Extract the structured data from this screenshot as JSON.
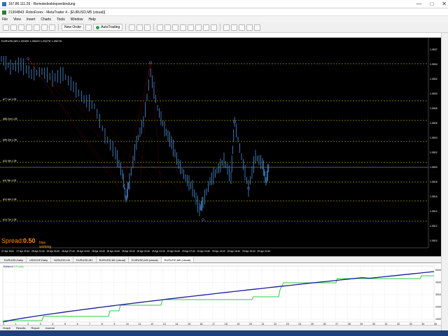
{
  "rdp": {
    "title": "167.86.111.26 - Remotedesktopverbindung",
    "controls": [
      "—",
      "□",
      "✕"
    ]
  },
  "terminal": {
    "title": "21304843: RoboForex - MetaTrader 4 - [EURUSD,M5 (visual)]"
  },
  "menu": [
    "File",
    "View",
    "Insert",
    "Charts",
    "Tools",
    "Window",
    "Help"
  ],
  "toolbar": {
    "new_order": "New Order",
    "autotrading": "AutoTrading",
    "autotrading_color": "#2ea043"
  },
  "chart": {
    "symbol_info": "EURUSD,M5  1.05309 1.05320 1.05278 1.05278",
    "spread_label": "Spread: ",
    "spread_value": "0.50",
    "status_line1": "bias",
    "status_line2": "working",
    "colors": {
      "background": "#000000",
      "candle": "#4a90d9",
      "level": "#e6e600",
      "current": "#c0c0c0",
      "fib": "#a01010"
    },
    "price_ticks": [
      "1.0537",
      "1.0534",
      "1.0532",
      "1.0530",
      "1.0528",
      "1.0526",
      "1.0524",
      "1.0522",
      "1.0520",
      "1.0518",
      "1.0516",
      "1.0514",
      "1.0512",
      "1.0510"
    ],
    "level_labels": [
      "#77 1st 1.05",
      "#88 2nd 1.05",
      "#99 3rd 1.05",
      "#10 4th 1.05",
      "#11 5th 1.05",
      "#12 6th 1.05",
      "#13 7th 1.05"
    ],
    "time_ticks": [
      "27 Apr 2022",
      "27 Apr 22:40",
      "28 Apr 01:40",
      "28 Apr 04:40",
      "28 Apr 07:40",
      "28 Apr 10:40",
      "28 Apr 13:40",
      "28 Apr 16:40",
      "28 Apr 19:40",
      "28 Apr 22:40",
      "29 Apr 01:40",
      "29 Apr 04:40",
      "29 Apr 07:40",
      "29 Apr 10:40",
      "29 Apr 13:40",
      "29 Apr 16:40",
      "29 Apr 19:40",
      "29 Apr 22:40"
    ]
  },
  "tabs": [
    "EURUSD,Daily",
    "USDCHF,Daily",
    "NZDUSD,H4",
    "EURUSD,M1",
    "EURUSD,M1 (visual)",
    "EURUSD,M5 (visual)",
    "EURUSD,M5 (visual)"
  ],
  "active_tab": 6,
  "report": {
    "legend_balance": "Balance",
    "legend_equity": "Equity",
    "y_ticks": [
      "5000",
      "4000",
      "3000",
      "2000",
      "1000"
    ],
    "x_ticks": [
      "0",
      "1",
      "2",
      "3",
      "4",
      "5",
      "6",
      "7",
      "8",
      "9",
      "10",
      "11",
      "12",
      "13",
      "14",
      "15",
      "16",
      "17",
      "18",
      "19",
      "20",
      "21",
      "22",
      "23",
      "24",
      "25",
      "26",
      "27",
      "28",
      "29",
      "30",
      "31",
      "32",
      "33",
      "34",
      "35"
    ],
    "colors": {
      "balance": "#1a1a9e",
      "equity": "#2ecc40"
    }
  },
  "bottom": {
    "items": [
      "Graph",
      "Results",
      "Report",
      "Journal"
    ]
  }
}
